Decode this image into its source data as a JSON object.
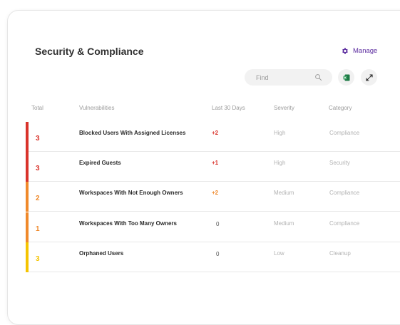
{
  "header": {
    "title": "Security & Compliance",
    "manage_label": "Manage"
  },
  "toolbar": {
    "search_placeholder": "Find",
    "export_icon": "excel-icon",
    "expand_icon": "expand-icon"
  },
  "table": {
    "columns": [
      "Total",
      "Vulnerabilities",
      "Last 30 Days",
      "Severity",
      "Category"
    ],
    "rows": [
      {
        "total": "3",
        "vulnerability": "Blocked Users With Assigned Licenses",
        "last30": "+2",
        "severity": "High",
        "category": "Compliance",
        "color": "#d9332b"
      },
      {
        "total": "3",
        "vulnerability": "Expired Guests",
        "last30": "+1",
        "severity": "High",
        "category": "Security",
        "color": "#d9332b"
      },
      {
        "total": "2",
        "vulnerability": "Workspaces With Not Enough Owners",
        "last30": "+2",
        "severity": "Medium",
        "category": "Compliance",
        "color": "#f0892a"
      },
      {
        "total": "1",
        "vulnerability": "Workspaces With Too Many Owners",
        "last30": "0",
        "severity": "Medium",
        "category": "Compliance",
        "color": "#f0892a"
      },
      {
        "total": "3",
        "vulnerability": "Orphaned Users",
        "last30": "0",
        "severity": "Low",
        "category": "Cleanup",
        "color": "#f5c400"
      }
    ]
  },
  "colors": {
    "accent": "#5a2a9e",
    "high": "#d9332b",
    "medium": "#f0892a",
    "low": "#f5c400"
  }
}
